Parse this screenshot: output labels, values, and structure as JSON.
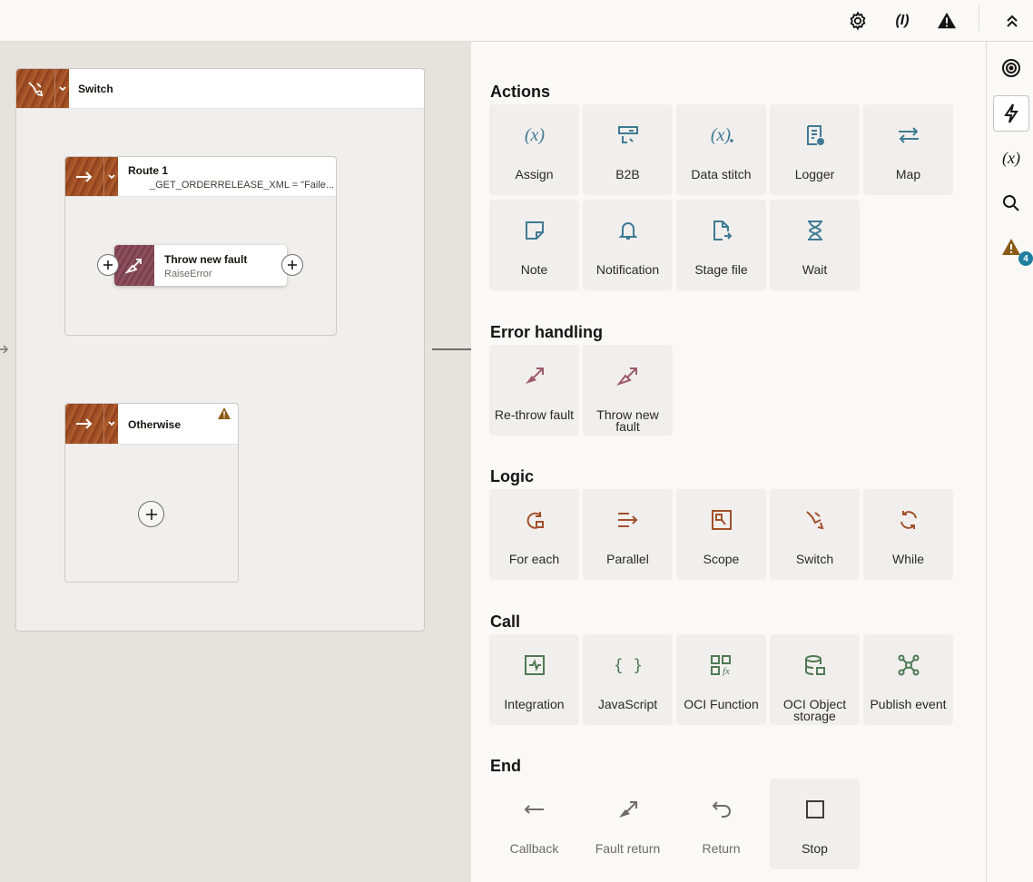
{
  "toolbar": {
    "settings_icon": "gear-icon",
    "expression_icon": "parens-i-icon",
    "expression_label": "(I)",
    "warning_icon": "warning-icon",
    "collapse_icon": "chevron-up-double-icon"
  },
  "canvas": {
    "switch": {
      "title": "Switch"
    },
    "route1": {
      "title": "Route 1",
      "condition": "_GET_ORDERRELEASE_XML = \"Faile..."
    },
    "throw_card": {
      "title": "Throw new fault",
      "subtitle": "RaiseError"
    },
    "otherwise": {
      "title": "Otherwise"
    }
  },
  "palette": {
    "sections": {
      "actions": "Actions",
      "error_handling": "Error handling",
      "logic": "Logic",
      "call": "Call",
      "end": "End"
    },
    "actions": [
      "Assign",
      "B2B",
      "Data stitch",
      "Logger",
      "Map",
      "Note",
      "Notification",
      "Stage file",
      "Wait"
    ],
    "error_handling": [
      "Re-throw fault",
      "Throw new fault"
    ],
    "logic": [
      "For each",
      "Parallel",
      "Scope",
      "Switch",
      "While"
    ],
    "call": [
      "Integration",
      "JavaScript",
      "OCI Function",
      "OCI Object storage",
      "Publish event"
    ],
    "end": [
      "Callback",
      "Fault return",
      "Return",
      "Stop"
    ],
    "colors": {
      "actions": "#3f7a94",
      "error": "#9c5a6a",
      "logic": "#a2502a",
      "call": "#4f7a55",
      "end": "#6f6c69"
    }
  },
  "rail": {
    "items": [
      "target-icon",
      "lightning-icon",
      "variable-icon",
      "search-icon",
      "warning-icon"
    ],
    "variable_label": "(x)",
    "warning_count": "4"
  }
}
